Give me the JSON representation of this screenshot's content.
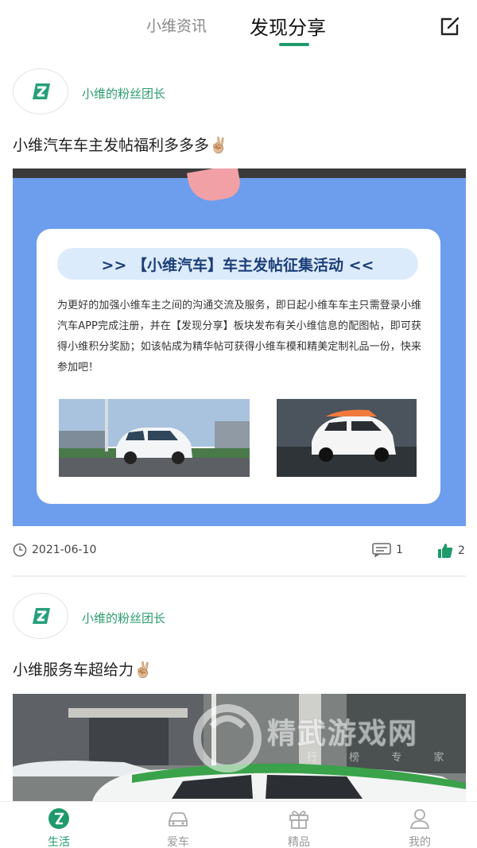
{
  "header": {
    "tabs": [
      {
        "label": "小维资讯",
        "active": false
      },
      {
        "label": "发现分享",
        "active": true
      }
    ],
    "edit_icon": "edit-icon"
  },
  "posts": [
    {
      "author": "小维的粉丝团长",
      "title": "小维汽车车主发帖福利多多多✌🏼",
      "poster": {
        "banner": ">> 【小维汽车】车主发帖征集活动 <<",
        "description": "为更好的加强小维车主之间的沟通交流及服务，即日起小维车车主只需登录小维汽车APP完成注册，并在【发现分享】板块发布有关小维信息的配图帖，即可获得小维积分奖励；如该帖成为精华帖可获得小维车模和精美定制礼品一份，快来参加吧！"
      },
      "date": "2021-06-10",
      "comments": "1",
      "likes": "2"
    },
    {
      "author": "小维的粉丝团长",
      "title": "小维服务车超给力✌🏼"
    }
  ],
  "watermark": {
    "text": "精武游戏网",
    "sub": "行 榜 专 家"
  },
  "bottom_nav": [
    {
      "label": "生活",
      "icon": "life-icon",
      "active": true
    },
    {
      "label": "爱车",
      "icon": "car-icon",
      "active": false
    },
    {
      "label": "精品",
      "icon": "gift-icon",
      "active": false
    },
    {
      "label": "我的",
      "icon": "profile-icon",
      "active": false
    }
  ],
  "colors": {
    "accent": "#1f9a6a",
    "poster_bg": "#6d9ded"
  }
}
